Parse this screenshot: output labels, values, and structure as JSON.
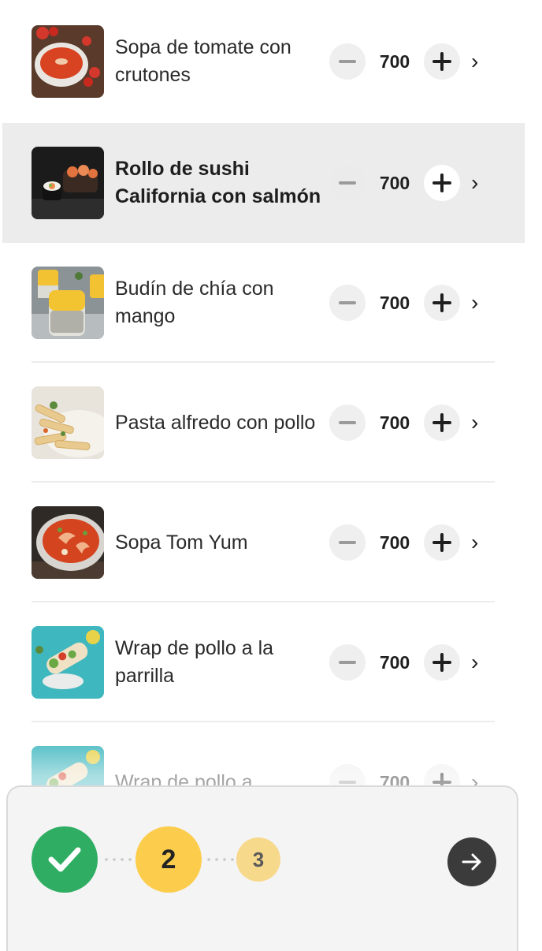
{
  "items": [
    {
      "name": "Sopa de tomate con crutones",
      "qty": "700"
    },
    {
      "name": "Rollo de sushi California con salmón",
      "qty": "700"
    },
    {
      "name": "Budín de chía con mango",
      "qty": "700"
    },
    {
      "name": "Pasta alfredo con pollo",
      "qty": "700"
    },
    {
      "name": "Sopa Tom Yum",
      "qty": "700"
    },
    {
      "name": "Wrap de pollo a la parrilla",
      "qty": "700"
    },
    {
      "name": "Wrap de pollo a",
      "qty": "700"
    }
  ],
  "stepper": {
    "step2": "2",
    "step3": "3"
  },
  "colors": {
    "done": "#2fae63",
    "current": "#fccd4d",
    "upcoming": "#f7d98c",
    "next_button": "#3b3b3b"
  }
}
